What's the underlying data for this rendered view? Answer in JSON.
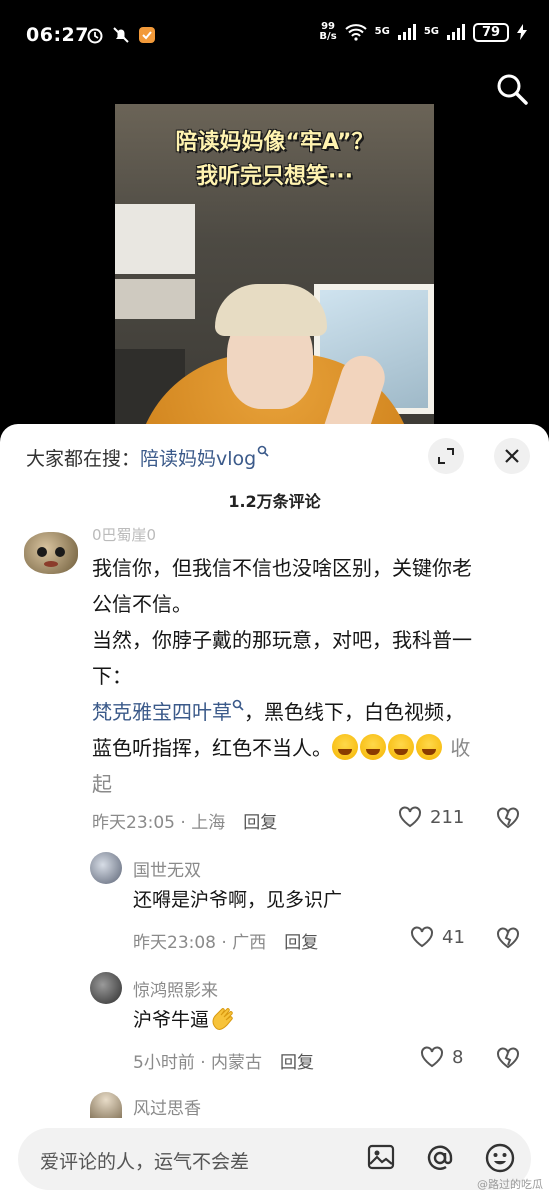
{
  "status_bar": {
    "time": "06:27",
    "net_speed_value": "99",
    "net_speed_unit": "B/s",
    "signal_1": "5G",
    "signal_2": "5G",
    "battery": "79"
  },
  "video": {
    "caption_line1": "陪读妈妈像“牢A”？",
    "caption_line2": "我听完只想笑···"
  },
  "sheet": {
    "search_prefix": "大家都在搜：",
    "search_link": "陪读妈妈vlog",
    "comment_count": "1.2万条评论"
  },
  "comments": [
    {
      "username": "0巴蜀崖0",
      "text_1": "我信你，但我信不信也没啥区别，关键你老",
      "text_2": "公信不信。",
      "text_3": "当然，你脖子戴的那玩意，对吧，我科普一",
      "text_4": "下：",
      "keyword": "梵克雅宝四叶草",
      "text_5": "，黑色线下，白色视频，",
      "text_6": "蓝色听指挥，红色不当人。",
      "fold_1": "收",
      "fold_2": "起",
      "time": "昨天23:05 · 上海",
      "reply": "回复",
      "likes": "211"
    },
    {
      "username": "国世无双",
      "text": "还嘚是沪爷啊，见多识广",
      "time": "昨天23:08 · 广西",
      "reply": "回复",
      "likes": "41"
    },
    {
      "username": "惊鸿照影来",
      "text": "沪爷牛逼",
      "time": "5小时前 · 内蒙古",
      "reply": "回复",
      "likes": "8"
    },
    {
      "username": "风过思香"
    }
  ],
  "input": {
    "placeholder": "爱评论的人，运气不会差"
  },
  "watermark": "@路过的吃瓜"
}
